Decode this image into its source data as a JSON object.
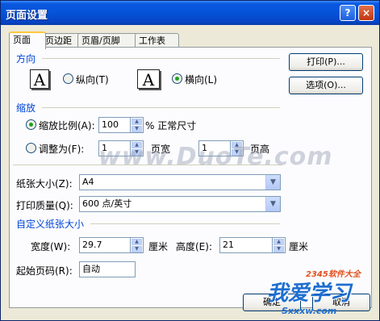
{
  "window": {
    "title": "页面设置",
    "help_icon": "?",
    "close_icon": "×"
  },
  "tabs": [
    {
      "label": "页面",
      "active": true
    },
    {
      "label": "页边距",
      "active": false
    },
    {
      "label": "页眉/页脚",
      "active": false
    },
    {
      "label": "工作表",
      "active": false
    }
  ],
  "orientation": {
    "section": "方向",
    "portrait_icon": "A",
    "portrait_label": "纵向(T)",
    "landscape_icon": "A",
    "landscape_label": "横向(L)",
    "selected": "landscape"
  },
  "side_buttons": {
    "print": "打印(P)...",
    "options": "选项(O)..."
  },
  "scaling": {
    "section": "缩放",
    "scale_label": "缩放比例(A):",
    "scale_value": "100",
    "scale_suffix": "% 正常尺寸",
    "fit_label": "调整为(F):",
    "fit_wide_value": "1",
    "fit_wide_suffix": "页宽",
    "fit_tall_value": "1",
    "fit_tall_suffix": "页高",
    "selected": "scale"
  },
  "paper": {
    "size_label": "纸张大小(Z):",
    "size_value": "A4",
    "quality_label": "打印质量(Q):",
    "quality_value": "600 点/英寸"
  },
  "custom": {
    "section": "自定义纸张大小",
    "width_label": "宽度(W):",
    "width_value": "29.7",
    "width_unit": "厘米",
    "height_label": "高度(E):",
    "height_value": "21",
    "height_unit": "厘米"
  },
  "start_page": {
    "label": "起始页码(R):",
    "value": "自动"
  },
  "bottom_buttons": {
    "ok": "确定",
    "cancel": "取消"
  },
  "watermarks": {
    "duote": "www.DuoTe.com",
    "logo1": "2345软件大全",
    "logo2": "我爱学习",
    "logo3": "Sxxxw.com"
  }
}
